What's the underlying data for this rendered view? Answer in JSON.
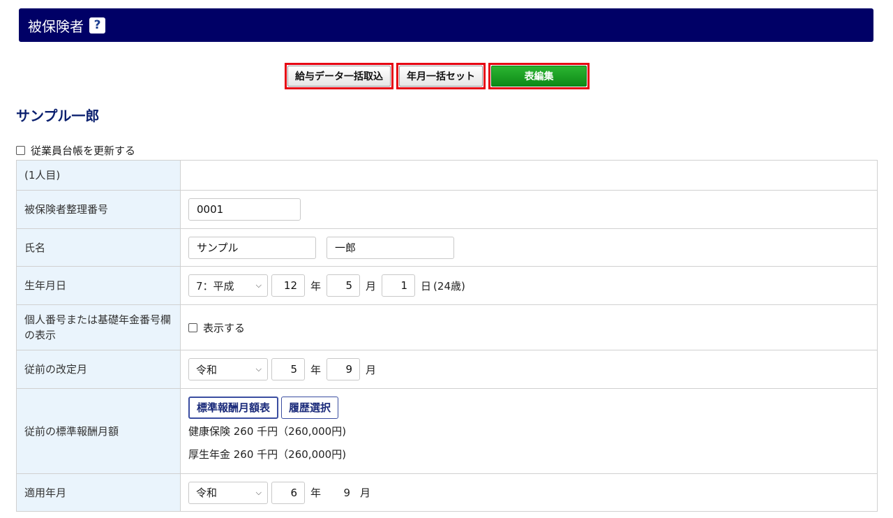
{
  "header": {
    "title": "被保険者",
    "help_icon": "?"
  },
  "toolbar": {
    "salary_import": "給与データ一括取込",
    "year_month_set": "年月一括セット",
    "table_edit": "表編集"
  },
  "person": {
    "name": "サンプル一郎"
  },
  "update_register": {
    "label": "従業員台帳を更新する",
    "checked": false
  },
  "form": {
    "index_label": "(1人目)",
    "insured_no": {
      "label": "被保険者整理番号",
      "value": "0001"
    },
    "name": {
      "label": "氏名",
      "last": "サンプル",
      "first": "一郎"
    },
    "birth": {
      "label": "生年月日",
      "era": "7：平成",
      "year": "12",
      "year_unit": "年",
      "month": "5",
      "month_unit": "月",
      "day": "1",
      "day_unit": "日",
      "age": "(24歳)"
    },
    "my_number": {
      "label": "個人番号または基礎年金番号欄の表示",
      "checkbox_label": "表示する",
      "checked": false
    },
    "prev_revision": {
      "label": "従前の改定月",
      "era": "令和",
      "year": "5",
      "year_unit": "年",
      "month": "9",
      "month_unit": "月"
    },
    "prev_salary": {
      "label": "従前の標準報酬月額",
      "table_btn": "標準報酬月額表",
      "history_btn": "履歴選択",
      "health": "健康保険 260 千円（260,000円)",
      "pension": "厚生年金 260 千円（260,000円)"
    },
    "apply": {
      "label": "適用年月",
      "era": "令和",
      "year": "6",
      "year_unit": "年",
      "month": "9",
      "month_unit": "月"
    }
  }
}
